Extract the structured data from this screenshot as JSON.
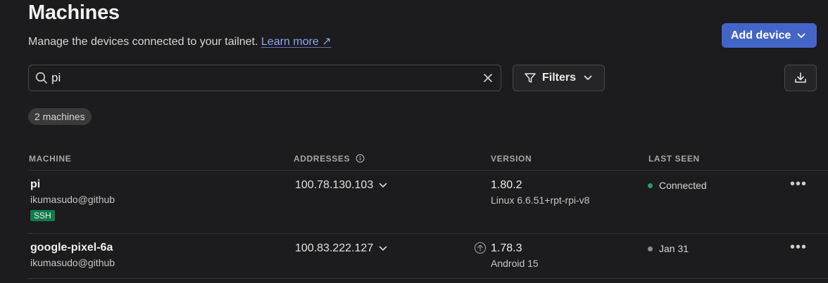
{
  "header": {
    "title": "Machines",
    "subtitle": "Manage the devices connected to your tailnet.",
    "learn_more": "Learn more",
    "learn_more_arrow": "↗",
    "add_device": "Add device"
  },
  "search": {
    "value": "pi",
    "placeholder": ""
  },
  "filters": {
    "label": "Filters"
  },
  "count_badge": "2 machines",
  "columns": {
    "machine": "MACHINE",
    "addresses": "ADDRESSES",
    "version": "VERSION",
    "last_seen": "LAST SEEN"
  },
  "machines": [
    {
      "name": "pi",
      "owner": "ikumasudo@github",
      "tag": "SSH",
      "address": "100.78.130.103",
      "version": "1.80.2",
      "os": "Linux 6.6.51+rpt-rpi-v8",
      "update_available": false,
      "last_seen": "Connected",
      "status_color": "#1ea26a"
    },
    {
      "name": "google-pixel-6a",
      "owner": "ikumasudo@github",
      "address": "100.83.222.127",
      "version": "1.78.3",
      "os": "Android 15",
      "update_available": true,
      "last_seen": "Jan 31",
      "status_color": "#8d8a87"
    }
  ],
  "icons": {
    "search": "search-icon",
    "clear": "close-icon",
    "filter": "filter-icon",
    "chevron": "chevron-down-icon",
    "download": "download-icon",
    "info": "info-icon",
    "update": "arrow-up-circle-icon",
    "more": "more-horizontal-icon"
  },
  "colors": {
    "background": "#1c1b1d",
    "accent": "#4465c8",
    "link": "#8fa7f5",
    "ssh_tag": "#13794a"
  }
}
